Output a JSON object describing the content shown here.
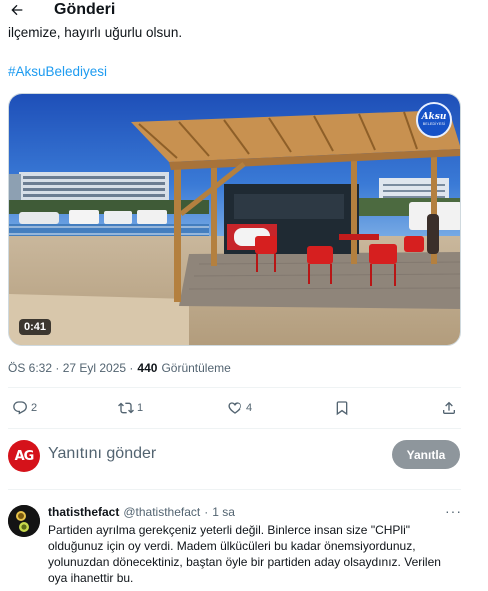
{
  "header": {
    "title": "Gönderi",
    "back_icon": "arrow-left-icon"
  },
  "tweet": {
    "text_partial": "ilçemize, hayırlı uğurlu olsun.",
    "hashtag": "#AksuBelediyesi",
    "media": {
      "duration": "0:41",
      "logo_line1": "Aksu",
      "logo_line2": "BELEDİYESİ"
    },
    "meta": {
      "time_date": "ÖS 6:32 · 27 Eyl 2025 · ",
      "views": "440",
      "views_label": "Görüntüleme"
    },
    "actions": {
      "reply_count": "2",
      "retweet_count": "1",
      "like_count": "4"
    }
  },
  "reply_composer": {
    "placeholder": "Yanıtını gönder",
    "avatar_text": "AG",
    "button_label": "Yanıtla"
  },
  "reply": {
    "name": "thatisthefact",
    "handle": "@thatisthefact",
    "separator": "·",
    "time": "1 sa",
    "more_label": "···",
    "text": "Partiden ayrılma gerekçeniz yeterli değil. Binlerce insan size \"CHPli\" olduğunuz için oy verdi. Madem ülkücüleri bu kadar önemsiyordunuz, yolunuzdan dönecektiniz, baştan öyle bir partiden aday olsaydınız. Verilen oya ihanettir bu."
  },
  "colors": {
    "accent": "#1d9bf0",
    "text": "#0f1419",
    "muted": "#536471",
    "reply_button": "#8e969c",
    "brand_red": "#d5121a"
  }
}
